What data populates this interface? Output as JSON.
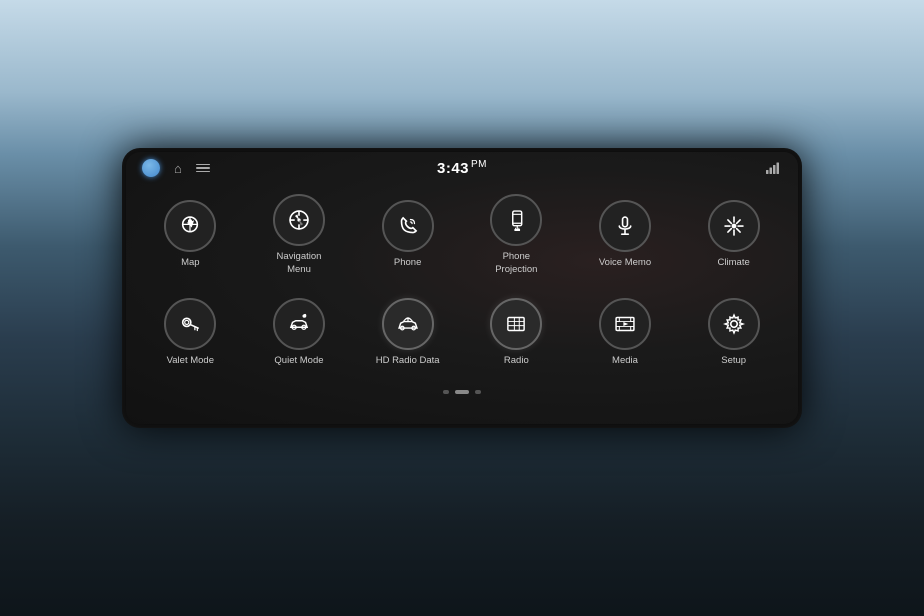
{
  "screen": {
    "time": "3:43",
    "time_period": "PM",
    "status_signal": "signal",
    "pagination": {
      "dots": [
        {
          "active": false
        },
        {
          "active": true
        },
        {
          "active": false
        }
      ]
    },
    "apps_row1": [
      {
        "id": "map",
        "label": "Map",
        "icon": "map"
      },
      {
        "id": "navigation-menu",
        "label": "Navigation\nMenu",
        "icon": "compass"
      },
      {
        "id": "phone",
        "label": "Phone",
        "icon": "phone"
      },
      {
        "id": "phone-projection",
        "label": "Phone\nProjection",
        "icon": "phone-projection"
      },
      {
        "id": "voice-memo",
        "label": "Voice Memo",
        "icon": "voice-memo"
      },
      {
        "id": "climate",
        "label": "Climate",
        "icon": "climate"
      }
    ],
    "apps_row2": [
      {
        "id": "valet-mode",
        "label": "Valet Mode",
        "icon": "valet"
      },
      {
        "id": "quiet-mode",
        "label": "Quiet Mode",
        "icon": "quiet"
      },
      {
        "id": "hd-radio-data",
        "label": "HD Radio Data",
        "icon": "hd-radio"
      },
      {
        "id": "radio",
        "label": "Radio",
        "icon": "radio"
      },
      {
        "id": "media",
        "label": "Media",
        "icon": "media"
      },
      {
        "id": "setup",
        "label": "Setup",
        "icon": "setup"
      }
    ]
  }
}
